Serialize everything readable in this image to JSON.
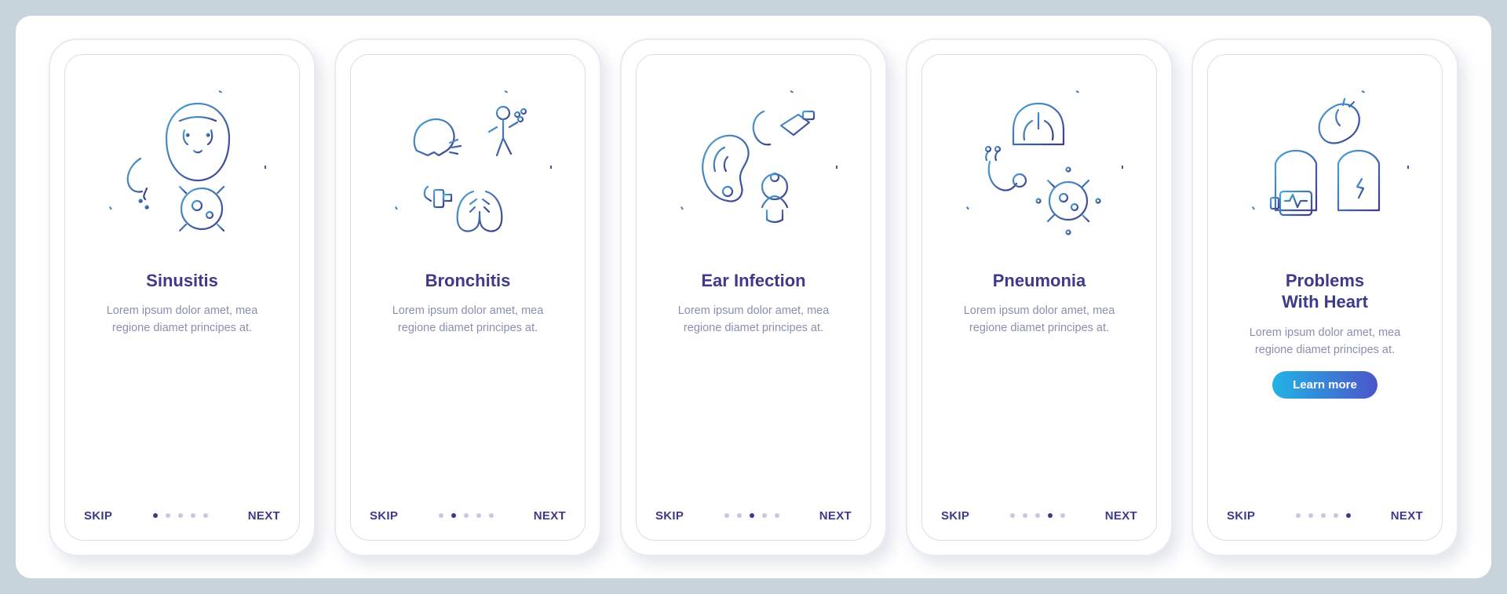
{
  "nav": {
    "skip": "SKIP",
    "next": "NEXT"
  },
  "cta_label": "Learn more",
  "screens": [
    {
      "title": "Sinusitis",
      "desc": "Lorem ipsum dolor amet, mea regione diamet principes at.",
      "active": 0,
      "cta": false,
      "icon": "sinusitis-icon"
    },
    {
      "title": "Bronchitis",
      "desc": "Lorem ipsum dolor amet, mea regione diamet principes at.",
      "active": 1,
      "cta": false,
      "icon": "bronchitis-icon"
    },
    {
      "title": "Ear Infection",
      "desc": "Lorem ipsum dolor amet, mea regione diamet principes at.",
      "active": 2,
      "cta": false,
      "icon": "ear-infection-icon"
    },
    {
      "title": "Pneumonia",
      "desc": "Lorem ipsum dolor amet, mea regione diamet principes at.",
      "active": 3,
      "cta": false,
      "icon": "pneumonia-icon"
    },
    {
      "title": "Problems With Heart",
      "desc": "Lorem ipsum dolor amet, mea regione diamet principes at.",
      "active": 4,
      "cta": true,
      "icon": "heart-problems-icon"
    }
  ],
  "total_dots": 5,
  "colors": {
    "stroke_light": "#4aa6d8",
    "stroke_dark": "#3d3a8a",
    "grad_a": "#22b3e6",
    "grad_b": "#4b55c9"
  }
}
